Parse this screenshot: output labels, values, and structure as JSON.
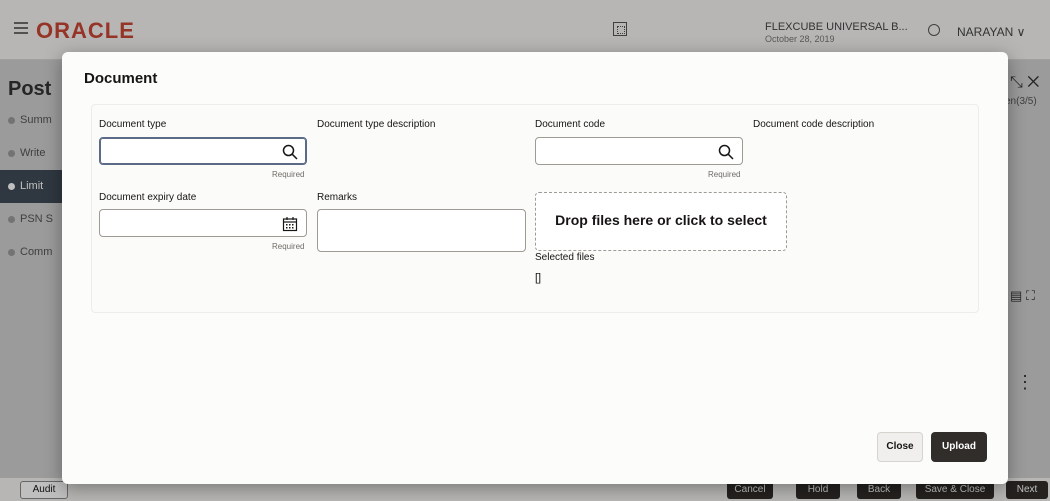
{
  "app": {
    "logo": "ORACLE",
    "entity_name": "FLEXCUBE UNIVERSAL B...",
    "entity_date": "October 28, 2019",
    "user": "NARAYAN"
  },
  "background": {
    "title": "Post",
    "steps": [
      {
        "label": "Summ"
      },
      {
        "label": "Write"
      },
      {
        "label": "Limit"
      },
      {
        "label": "PSN S"
      },
      {
        "label": "Comm"
      }
    ],
    "right_sub": "en(3/5)",
    "footer": {
      "audit": "Audit",
      "cancel": "Cancel",
      "hold": "Hold",
      "back": "Back",
      "save_close": "Save & Close",
      "next": "Next"
    }
  },
  "modal": {
    "title": "Document",
    "fields": {
      "document_type": {
        "label": "Document type",
        "value": "",
        "required": "Required"
      },
      "document_type_description": {
        "label": "Document type description"
      },
      "document_code": {
        "label": "Document code",
        "value": "",
        "required": "Required"
      },
      "document_code_description": {
        "label": "Document code description"
      },
      "document_expiry_date": {
        "label": "Document expiry date",
        "value": "",
        "required": "Required"
      },
      "remarks": {
        "label": "Remarks",
        "value": ""
      }
    },
    "dropzone": "Drop files here or click to select",
    "selected_files_label": "Selected files",
    "selected_files_value": "[]",
    "buttons": {
      "close": "Close",
      "upload": "Upload"
    }
  }
}
